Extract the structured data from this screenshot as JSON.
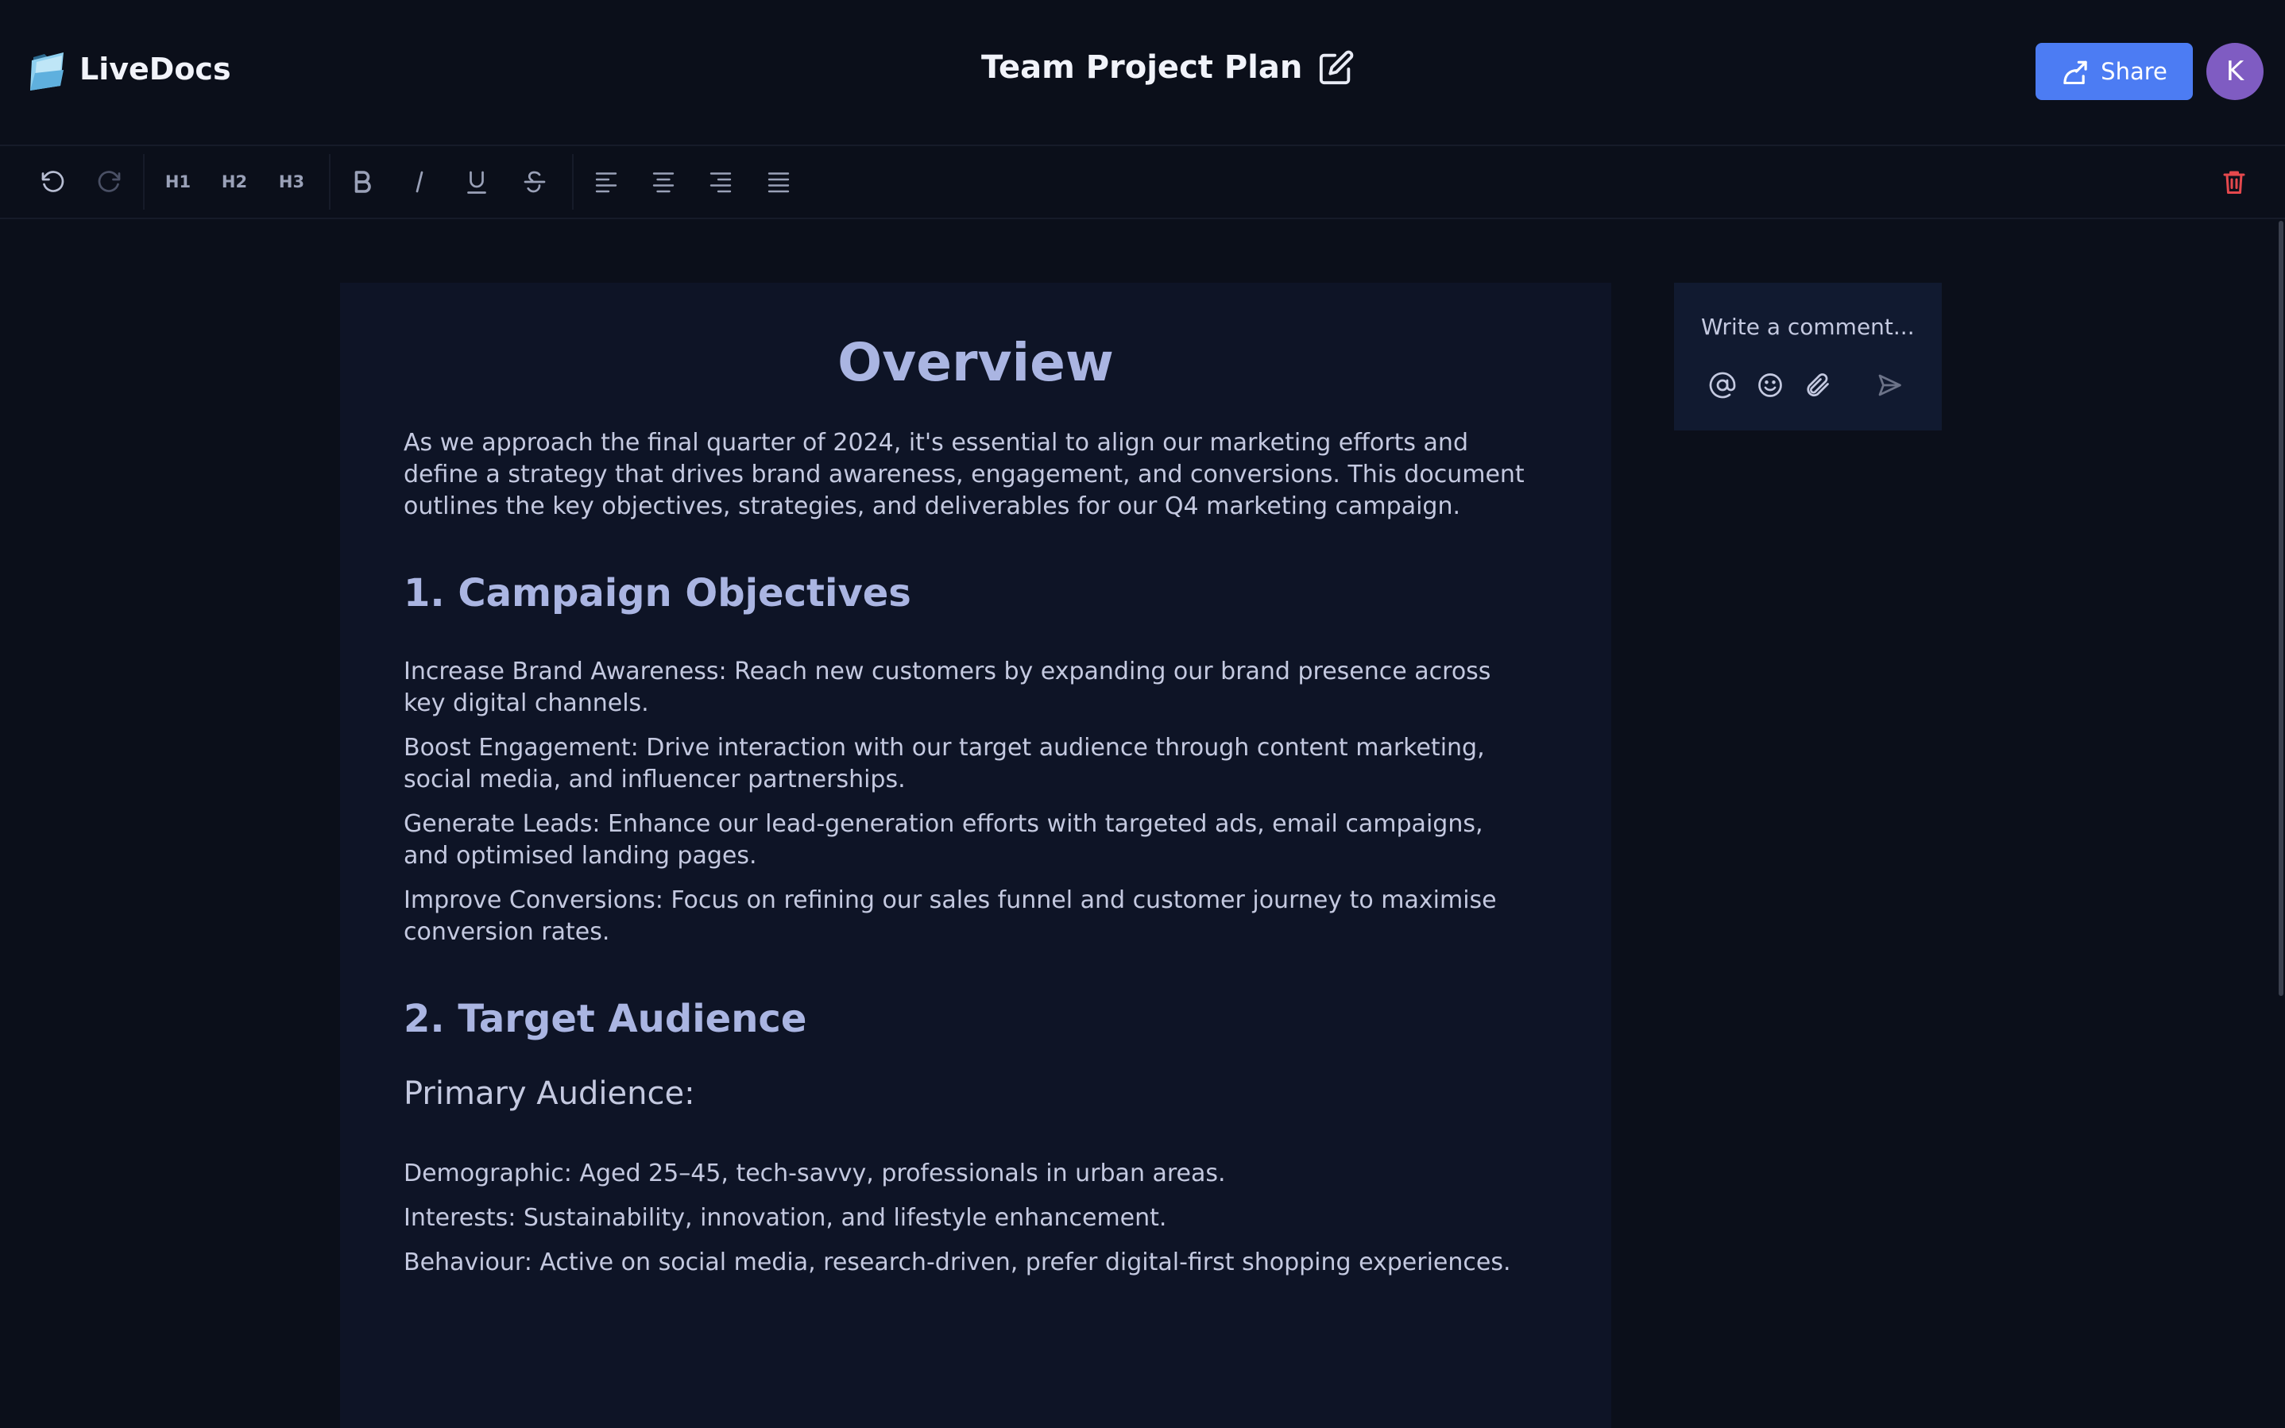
{
  "app": {
    "name": "LiveDocs"
  },
  "document": {
    "title": "Team Project Plan"
  },
  "header": {
    "share_label": "Share",
    "avatar_initial": "K"
  },
  "toolbar": {
    "h1_label": "H1",
    "h2_label": "H2",
    "h3_label": "H3",
    "icons": [
      "undo-icon",
      "redo-icon",
      "bold-icon",
      "italic-icon",
      "underline-icon",
      "strikethrough-icon",
      "align-left-icon",
      "align-center-icon",
      "align-right-icon",
      "align-justify-icon",
      "trash-icon"
    ]
  },
  "content": {
    "heading": "Overview",
    "intro": "As we approach the final quarter of 2024, it's essential to align our marketing efforts and define a strategy that drives brand awareness, engagement, and conversions. This document outlines the key objectives, strategies, and deliverables for our Q4 marketing campaign.",
    "section1": {
      "title": "1. Campaign Objectives",
      "items": [
        "Increase Brand Awareness: Reach new customers by expanding our brand presence across key digital channels.",
        "Boost Engagement: Drive interaction with our target audience through content marketing, social media, and influencer partnerships.",
        "Generate Leads: Enhance our lead-generation efforts with targeted ads, email campaigns, and optimised landing pages.",
        "Improve Conversions: Focus on refining our sales funnel and customer journey to maximise conversion rates."
      ]
    },
    "section2": {
      "title": "2. Target Audience",
      "subtitle": "Primary Audience:",
      "items": [
        "Demographic: Aged 25–45, tech-savvy, professionals in urban areas.",
        "Interests: Sustainability, innovation, and lifestyle enhancement.",
        "Behaviour: Active on social media, research-driven, prefer digital-first shopping experiences."
      ]
    }
  },
  "comment": {
    "placeholder": "Write a comment..."
  },
  "colors": {
    "background": "#0b0f1a",
    "page": "#0e1426",
    "accent": "#4c7cf3",
    "avatar": "#7f5cc2",
    "danger": "#e5484d",
    "heading": "#aab5e2"
  }
}
